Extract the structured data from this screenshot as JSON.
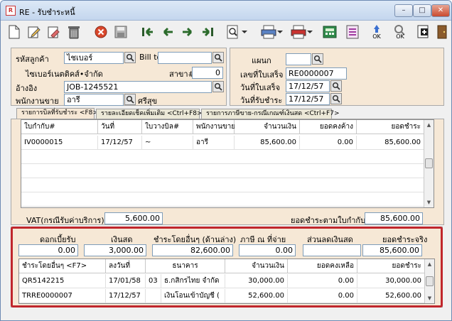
{
  "window": {
    "title": "RE - รับชำระหนี้",
    "min": "–",
    "max": "□",
    "close": "✕"
  },
  "toolbar": {
    "icons": [
      "new-doc",
      "edit",
      "eraser",
      "trash",
      "stop",
      "save",
      "first",
      "prev",
      "next",
      "last",
      "search",
      "print-preview",
      "print",
      "calculator",
      "report",
      "approve",
      "ok-search",
      "export"
    ],
    "ok_label": "OK"
  },
  "header_left": {
    "customer_code_label": "รหัสลูกค้า",
    "customer_code": "ไชเบอร์",
    "bill_to_label": "Bill to",
    "bill_to": "",
    "customer_name": "ไซเบอร์เนตติคส์•จำกัด",
    "branch_label": "สาขา#",
    "branch": "0",
    "ref_label": "อ้างอิง",
    "ref": "JOB-1245521",
    "salesman_label": "พนักงานขาย",
    "salesman_code": "อารี",
    "salesman_name": "ศรีสุข"
  },
  "header_right": {
    "dept_label": "แผนก",
    "dept": "",
    "receipt_no_label": "เลขที่ใบเสร็จ",
    "receipt_no": "RE0000007",
    "receipt_date_label": "วันที่ใบเสร็จ",
    "receipt_date": "17/12/57",
    "pay_date_label": "วันที่รับชำระ",
    "pay_date": "17/12/57"
  },
  "tabs": [
    {
      "label": "รายการบิลที่รับชำระ <F8>"
    },
    {
      "label": "รายละเอียดเช็คเพิ่มเติม <Ctrl+F8>"
    },
    {
      "label": "รายการภาษีขาย-กรณีเกณฑ์เงินสด <Ctrl+F7>"
    }
  ],
  "invoice_grid": {
    "columns": [
      "ใบกำกับ#",
      "วันที่",
      "ใบวางบิล#",
      "พนักงานขาย",
      "จำนวนเงิน",
      "ยอดคงค้าง",
      "ยอดชำระ"
    ],
    "rows": [
      [
        "IV0000015",
        "17/12/57",
        "~",
        "อารี",
        "85,600.00",
        "0.00",
        "85,600.00"
      ]
    ]
  },
  "vat": {
    "label": "VAT(กรณีรับค่าบริการ)",
    "value": "5,600.00"
  },
  "pay_by_invoice": {
    "label": "ยอดชำระตามใบกำกับ",
    "value": "85,600.00"
  },
  "summary": {
    "interest_label": "ดอกเบี้ยรับ",
    "interest": "0.00",
    "cash_label": "เงินสด",
    "cash": "3,000.00",
    "other_label": "ชำระโดยอื่นๆ (ด้านล่าง)",
    "other": "82,600.00",
    "wht_label": "ภาษี ณ ที่จ่าย",
    "wht": "0.00",
    "discount_label": "ส่วนลดเงินสด",
    "discount": "",
    "actual_label": "ยอดชำระจริง",
    "actual": "85,600.00"
  },
  "other_grid": {
    "columns": [
      "ชำระโดยอื่นๆ <F7>",
      "ลงวันที่",
      "ธนาคาร",
      "จำนวนเงิน",
      "ยอดคงเหลือ",
      "ยอดชำระ"
    ],
    "rows": [
      [
        "QR5142215",
        "17/01/58",
        "03",
        "ธ.กสิกรไทย จำกัด",
        "30,000.00",
        "0.00",
        "30,000.00"
      ],
      [
        "TRRE0000007",
        "17/12/57",
        "",
        "เงินโอนเข้าบัญชี (",
        "52,600.00",
        "0.00",
        "52,600.00"
      ]
    ]
  }
}
